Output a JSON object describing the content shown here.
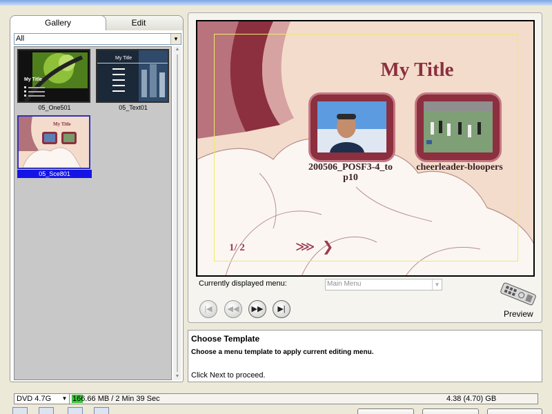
{
  "tabs": {
    "gallery": "Gallery",
    "edit": "Edit"
  },
  "filter": {
    "value": "All"
  },
  "templates": [
    {
      "caption": "05_One501"
    },
    {
      "caption": "05_Text01"
    },
    {
      "caption": "05_Sce801",
      "selected": true
    }
  ],
  "thumb_texts": {
    "my_title": "My Title"
  },
  "preview": {
    "title": "My Title",
    "clips": [
      {
        "label": "200506_POSF3-4_to p10"
      },
      {
        "label": "cheerleader-bloopers"
      }
    ],
    "page_indicator": "1/ 2",
    "nav_glyph": "⋙ ❯"
  },
  "menu": {
    "label": "Currently displayed menu:",
    "value": "Main Menu"
  },
  "preview_button": {
    "label": "Preview"
  },
  "help": {
    "title": "Choose Template",
    "description": "Choose a menu template to apply current editing menu.",
    "next_hint": "Click Next to proceed."
  },
  "status": {
    "disc": "DVD 4.7G",
    "usage": "166.66 MB / 2 Min 39 Sec",
    "usage_fraction": 0.035,
    "capacity": "4.38 (4.70) GB"
  },
  "colors": {
    "accent": "#8c2f3f",
    "selection": "#1414e6",
    "usage_bar": "#35c63a"
  },
  "icons": [
    "first-chapter-icon",
    "previous-icon",
    "next-icon",
    "last-chapter-icon",
    "remote-control-icon"
  ]
}
